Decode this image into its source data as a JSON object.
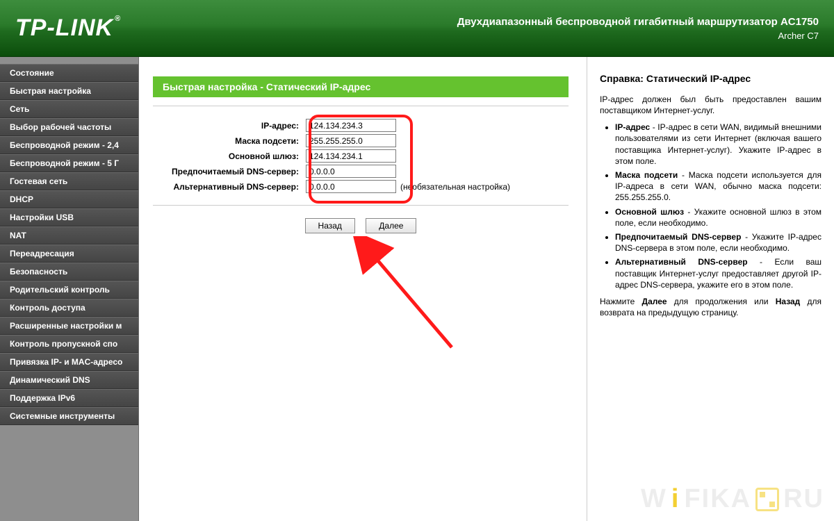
{
  "header": {
    "logo_text": "TP-LINK",
    "logo_reg": "®",
    "title": "Двухдиапазонный беспроводной гигабитный маршрутизатор AC1750",
    "sub": "Archer C7"
  },
  "sidebar": {
    "items": [
      "Состояние",
      "Быстрая настройка",
      "Сеть",
      "Выбор рабочей частоты",
      "Беспроводной режим - 2,4",
      "Беспроводной режим - 5 Г",
      "Гостевая сеть",
      "DHCP",
      "Настройки USB",
      "NAT",
      "Переадресация",
      "Безопасность",
      "Родительский контроль",
      "Контроль доступа",
      "Расширенные настройки м",
      "Контроль пропускной спо",
      "Привязка IP- и MAC-адресо",
      "Динамический DNS",
      "Поддержка IPv6",
      "Системные инструменты"
    ]
  },
  "main": {
    "section_title": "Быстрая настройка - Статический IP-адрес",
    "fields": {
      "ip_label": "IP-адрес:",
      "ip_value": "124.134.234.3",
      "mask_label": "Маска подсети:",
      "mask_value": "255.255.255.0",
      "gw_label": "Основной шлюз:",
      "gw_value": "124.134.234.1",
      "dns1_label": "Предпочитаемый DNS-сервер:",
      "dns1_value": "0.0.0.0",
      "dns2_label": "Альтернативный DNS-сервер:",
      "dns2_value": "0.0.0.0",
      "optional_note": "(необязательная настройка)"
    },
    "buttons": {
      "back": "Назад",
      "next": "Далее"
    }
  },
  "help": {
    "title": "Справка: Статический IP-адрес",
    "intro": "IP-адрес должен был быть предоставлен вашим поставщиком Интернет-услуг.",
    "items": [
      {
        "term": "IP-адрес",
        "text": " - IP-адрес в сети WAN, видимый внешними пользователями из сети Интернет (включая вашего поставщика Интернет-услуг). Укажите IP-адрес в этом поле."
      },
      {
        "term": "Маска подсети",
        "text": " - Маска подсети используется для IP-адреса в сети WAN, обычно маска подсети: 255.255.255.0."
      },
      {
        "term": "Основной шлюз",
        "text": " - Укажите основной шлюз в этом поле, если необходимо."
      },
      {
        "term": "Предпочитаемый DNS-сервер",
        "text": " - Укажите IP-адрес DNS-сервера в этом поле, если необходимо."
      },
      {
        "term": "Альтернативный DNS-сервер",
        "text": " - Если ваш поставщик Интернет-услуг предоставляет другой IP-адрес DNS-сервера, укажите его в этом поле."
      }
    ],
    "outro_before": "Нажмите ",
    "outro_next": "Далее",
    "outro_mid": " для продолжения или ",
    "outro_back": "Назад",
    "outro_after": " для возврата на предыдущую страницу."
  },
  "watermark": {
    "left": "W",
    "mid_i": "i",
    "mid": "FIKA",
    "right": "RU"
  }
}
